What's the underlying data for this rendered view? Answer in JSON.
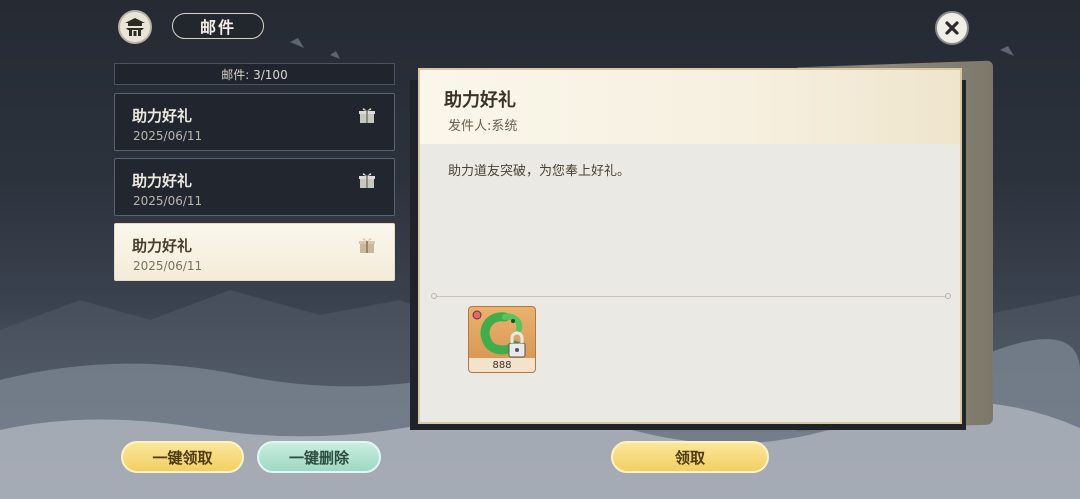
{
  "header": {
    "title": "邮件",
    "home_icon": "pagoda-icon",
    "close_icon": "close-icon"
  },
  "mail_count": "邮件: 3/100",
  "mail_list": [
    {
      "title": "助力好礼",
      "date": "2025/06/11",
      "icon": "gift-icon",
      "selected": false
    },
    {
      "title": "助力好礼",
      "date": "2025/06/11",
      "icon": "gift-icon",
      "selected": false
    },
    {
      "title": "助力好礼",
      "date": "2025/06/11",
      "icon": "gift-icon",
      "selected": true
    }
  ],
  "detail": {
    "title": "助力好礼",
    "sender": "发件人:系统",
    "body": "助力道友突破，为您奉上好礼。",
    "reward": {
      "icon": "green-dragon-icon",
      "quantity": "888",
      "locked": true
    }
  },
  "buttons": {
    "claim_all": "一键领取",
    "delete_all": "一键删除",
    "claim": "领取"
  },
  "colors": {
    "accent_gold": "#f1cf62",
    "accent_mint": "#9fd9c3",
    "panel": "#ebe9e3"
  }
}
